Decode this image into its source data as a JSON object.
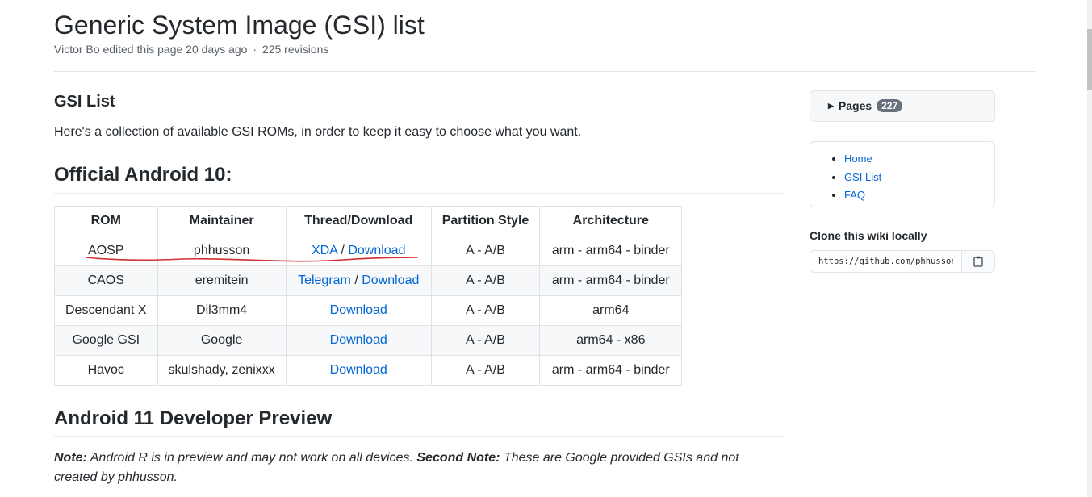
{
  "header": {
    "title": "Generic System Image (GSI) list",
    "editor": "Victor Bo",
    "edited_text": "edited this page 20 days ago",
    "separator": "·",
    "revisions": "225 revisions"
  },
  "content": {
    "gsi_heading": "GSI List",
    "intro": "Here's a collection of available GSI ROMs, in order to keep it easy to choose what you want.",
    "section1": "Official Android 10:",
    "section2": "Android 11 Developer Preview",
    "note": {
      "label1": "Note:",
      "text1": " Android R is in preview and may not work on all devices. ",
      "label2": "Second Note:",
      "text2": " These are Google provided GSIs and not created by phhusson."
    }
  },
  "table": {
    "headers": [
      "ROM",
      "Maintainer",
      "Thread/Download",
      "Partition Style",
      "Architecture"
    ],
    "rows": [
      {
        "rom": "AOSP",
        "maintainer": "phhusson",
        "link1": "XDA",
        "sep": " / ",
        "link2": "Download",
        "partition": "A - A/B",
        "arch": "arm - arm64 - binder"
      },
      {
        "rom": "CAOS",
        "maintainer": "eremitein",
        "link1": "Telegram",
        "sep": " / ",
        "link2": "Download",
        "partition": "A - A/B",
        "arch": "arm - arm64 - binder"
      },
      {
        "rom": "Descendant X",
        "maintainer": "Dil3mm4",
        "link2": "Download",
        "partition": "A - A/B",
        "arch": "arm64"
      },
      {
        "rom": "Google GSI",
        "maintainer": "Google",
        "link2": "Download",
        "partition": "A - A/B",
        "arch": "arm64 - x86"
      },
      {
        "rom": "Havoc",
        "maintainer": "skulshady, zenixxx",
        "link2": "Download",
        "partition": "A - A/B",
        "arch": "arm - arm64 - binder"
      }
    ]
  },
  "sidebar": {
    "pages_label": "Pages",
    "pages_count": "227",
    "nav": [
      "Home",
      "GSI List",
      "FAQ"
    ],
    "clone_label": "Clone this wiki locally",
    "clone_url": "https://github.com/phhusson/treble_experimentations.wiki.git"
  },
  "colors": {
    "link": "#0366d6",
    "annotation": "#d32f2f"
  },
  "icons": [
    "caret-right-icon",
    "clipboard-icon"
  ]
}
